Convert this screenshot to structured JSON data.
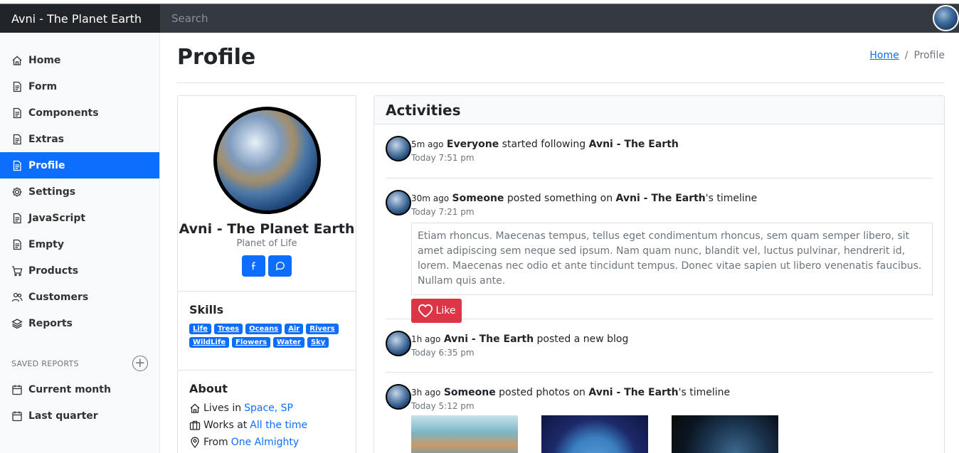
{
  "navbar": {
    "brand": "Avni - The Planet Earth",
    "search_placeholder": "Search"
  },
  "sidebar": {
    "items": [
      {
        "label": "Home",
        "icon": "house-icon",
        "active": false
      },
      {
        "label": "Form",
        "icon": "file-icon",
        "active": false
      },
      {
        "label": "Components",
        "icon": "file-icon",
        "active": false
      },
      {
        "label": "Extras",
        "icon": "file-icon",
        "active": false
      },
      {
        "label": "Profile",
        "icon": "file-icon",
        "active": true
      },
      {
        "label": "Settings",
        "icon": "gear-icon",
        "active": false
      },
      {
        "label": "JavaScript",
        "icon": "file-icon",
        "active": false
      },
      {
        "label": "Empty",
        "icon": "file-icon",
        "active": false
      },
      {
        "label": "Products",
        "icon": "cart-icon",
        "active": false
      },
      {
        "label": "Customers",
        "icon": "people-icon",
        "active": false
      },
      {
        "label": "Reports",
        "icon": "layers-icon",
        "active": false
      }
    ],
    "saved_reports_heading": "SAVED REPORTS",
    "saved_items": [
      {
        "label": "Current month",
        "icon": "calendar-icon"
      },
      {
        "label": "Last quarter",
        "icon": "calendar-icon"
      }
    ]
  },
  "page": {
    "title": "Profile",
    "breadcrumb": {
      "home": "Home",
      "separator": "/",
      "current": "Profile"
    }
  },
  "profile": {
    "name": "Avni - The Planet Earth",
    "subtitle": "Planet of Life",
    "skills_title": "Skills",
    "skills": [
      "Life",
      "Trees",
      "Oceans",
      "Air",
      "Rivers",
      "WildLife",
      "Flowers",
      "Water",
      "Sky"
    ],
    "about_title": "About",
    "about": {
      "lives_label": "Lives in",
      "lives_link": "Space, SP",
      "works_label": "Works at",
      "works_link": "All the time",
      "from_label": "From",
      "from_link": "One Almighty"
    }
  },
  "activities": {
    "title": "Activities",
    "items": [
      {
        "ago": "5m ago",
        "actor": "Everyone",
        "verb": "started following",
        "target": "Avni - The Earth",
        "suffix": "",
        "time": "Today 7:51 pm"
      },
      {
        "ago": "30m ago",
        "actor": "Someone",
        "verb": "posted something on",
        "target": "Avni - The Earth",
        "suffix": "'s timeline",
        "time": "Today 7:21 pm",
        "quote": "Etiam rhoncus. Maecenas tempus, tellus eget condimentum rhoncus, sem quam semper libero, sit amet adipiscing sem neque sed ipsum. Nam quam nunc, blandit vel, luctus pulvinar, hendrerit id, lorem. Maecenas nec odio et ante tincidunt tempus. Donec vitae sapien ut libero venenatis faucibus. Nullam quis ante.",
        "like_label": "Like"
      },
      {
        "ago": "1h ago",
        "actor": "Avni - The Earth",
        "verb": "posted a new blog",
        "target": "",
        "suffix": "",
        "time": "Today 6:35 pm"
      },
      {
        "ago": "3h ago",
        "actor": "Someone",
        "verb": "posted photos on",
        "target": "Avni - The Earth",
        "suffix": "'s timeline",
        "time": "Today 5:12 pm"
      }
    ]
  },
  "colors": {
    "primary": "#0d6efd",
    "danger": "#dc3545",
    "navbar": "#343a40"
  }
}
